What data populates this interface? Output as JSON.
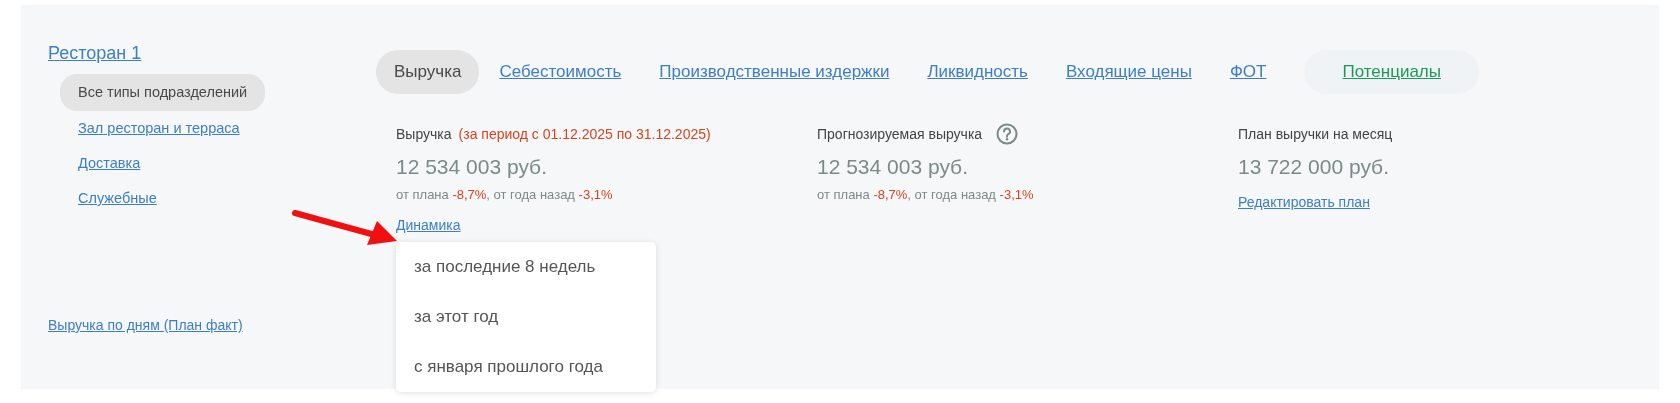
{
  "restaurant": {
    "name": "Ресторан 1"
  },
  "subdivisions": [
    {
      "label": "Все типы подразделений",
      "selected": true
    },
    {
      "label": "Зал ресторан и терраса",
      "selected": false
    },
    {
      "label": "Доставка",
      "selected": false
    },
    {
      "label": "Служебные",
      "selected": false
    }
  ],
  "report_link": "Выручка по дням (План факт)",
  "tabs": [
    {
      "label": "Выручка",
      "selected": true,
      "kind": "normal"
    },
    {
      "label": "Себестоимость",
      "selected": false,
      "kind": "normal"
    },
    {
      "label": "Производственные издержки",
      "selected": false,
      "kind": "normal"
    },
    {
      "label": "Ликвидность",
      "selected": false,
      "kind": "normal"
    },
    {
      "label": "Входящие цены",
      "selected": false,
      "kind": "normal"
    },
    {
      "label": "ФОТ",
      "selected": false,
      "kind": "normal"
    },
    {
      "label": "Потенциалы",
      "selected": false,
      "kind": "accent"
    }
  ],
  "metrics": [
    {
      "title": "Выручка",
      "period": "(за период с 01.12.2025 по 31.12.2025)",
      "help": false,
      "value": "12 534 003 руб.",
      "deviations": [
        {
          "label": "от плана ",
          "value": "-8,7%"
        },
        {
          "label": ", от года назад ",
          "value": "-3,1%"
        }
      ],
      "link": "Динамика",
      "menu": {
        "expanded": true,
        "items": [
          "за последние 8 недель",
          "за этот год",
          "с января прошлого года"
        ]
      }
    },
    {
      "title": "Прогнозируемая выручка",
      "help": true,
      "value": "12 534 003 руб.",
      "deviations": [
        {
          "label": "от плана ",
          "value": "-8,7%"
        },
        {
          "label": ", от года назад ",
          "value": "-3,1%"
        }
      ]
    },
    {
      "title": "План выручки на месяц",
      "help": false,
      "value": "13 722 000 руб.",
      "link": "Редактировать план"
    }
  ]
}
